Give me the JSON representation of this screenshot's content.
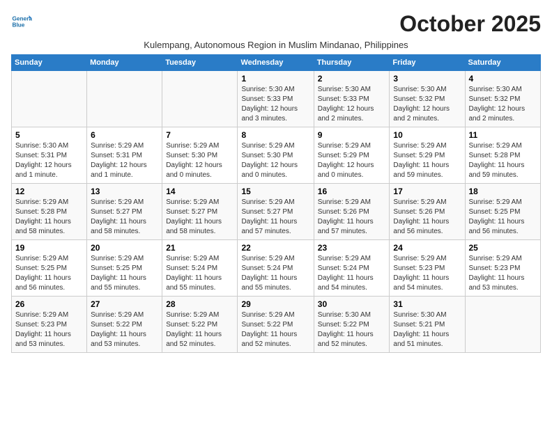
{
  "logo": {
    "name1": "General",
    "name2": "Blue"
  },
  "title": "October 2025",
  "subtitle": "Kulempang, Autonomous Region in Muslim Mindanao, Philippines",
  "headers": [
    "Sunday",
    "Monday",
    "Tuesday",
    "Wednesday",
    "Thursday",
    "Friday",
    "Saturday"
  ],
  "weeks": [
    [
      {
        "num": "",
        "info": ""
      },
      {
        "num": "",
        "info": ""
      },
      {
        "num": "",
        "info": ""
      },
      {
        "num": "1",
        "info": "Sunrise: 5:30 AM\nSunset: 5:33 PM\nDaylight: 12 hours and 3 minutes."
      },
      {
        "num": "2",
        "info": "Sunrise: 5:30 AM\nSunset: 5:33 PM\nDaylight: 12 hours and 2 minutes."
      },
      {
        "num": "3",
        "info": "Sunrise: 5:30 AM\nSunset: 5:32 PM\nDaylight: 12 hours and 2 minutes."
      },
      {
        "num": "4",
        "info": "Sunrise: 5:30 AM\nSunset: 5:32 PM\nDaylight: 12 hours and 2 minutes."
      }
    ],
    [
      {
        "num": "5",
        "info": "Sunrise: 5:30 AM\nSunset: 5:31 PM\nDaylight: 12 hours and 1 minute."
      },
      {
        "num": "6",
        "info": "Sunrise: 5:29 AM\nSunset: 5:31 PM\nDaylight: 12 hours and 1 minute."
      },
      {
        "num": "7",
        "info": "Sunrise: 5:29 AM\nSunset: 5:30 PM\nDaylight: 12 hours and 0 minutes."
      },
      {
        "num": "8",
        "info": "Sunrise: 5:29 AM\nSunset: 5:30 PM\nDaylight: 12 hours and 0 minutes."
      },
      {
        "num": "9",
        "info": "Sunrise: 5:29 AM\nSunset: 5:29 PM\nDaylight: 12 hours and 0 minutes."
      },
      {
        "num": "10",
        "info": "Sunrise: 5:29 AM\nSunset: 5:29 PM\nDaylight: 11 hours and 59 minutes."
      },
      {
        "num": "11",
        "info": "Sunrise: 5:29 AM\nSunset: 5:28 PM\nDaylight: 11 hours and 59 minutes."
      }
    ],
    [
      {
        "num": "12",
        "info": "Sunrise: 5:29 AM\nSunset: 5:28 PM\nDaylight: 11 hours and 58 minutes."
      },
      {
        "num": "13",
        "info": "Sunrise: 5:29 AM\nSunset: 5:27 PM\nDaylight: 11 hours and 58 minutes."
      },
      {
        "num": "14",
        "info": "Sunrise: 5:29 AM\nSunset: 5:27 PM\nDaylight: 11 hours and 58 minutes."
      },
      {
        "num": "15",
        "info": "Sunrise: 5:29 AM\nSunset: 5:27 PM\nDaylight: 11 hours and 57 minutes."
      },
      {
        "num": "16",
        "info": "Sunrise: 5:29 AM\nSunset: 5:26 PM\nDaylight: 11 hours and 57 minutes."
      },
      {
        "num": "17",
        "info": "Sunrise: 5:29 AM\nSunset: 5:26 PM\nDaylight: 11 hours and 56 minutes."
      },
      {
        "num": "18",
        "info": "Sunrise: 5:29 AM\nSunset: 5:25 PM\nDaylight: 11 hours and 56 minutes."
      }
    ],
    [
      {
        "num": "19",
        "info": "Sunrise: 5:29 AM\nSunset: 5:25 PM\nDaylight: 11 hours and 56 minutes."
      },
      {
        "num": "20",
        "info": "Sunrise: 5:29 AM\nSunset: 5:25 PM\nDaylight: 11 hours and 55 minutes."
      },
      {
        "num": "21",
        "info": "Sunrise: 5:29 AM\nSunset: 5:24 PM\nDaylight: 11 hours and 55 minutes."
      },
      {
        "num": "22",
        "info": "Sunrise: 5:29 AM\nSunset: 5:24 PM\nDaylight: 11 hours and 55 minutes."
      },
      {
        "num": "23",
        "info": "Sunrise: 5:29 AM\nSunset: 5:24 PM\nDaylight: 11 hours and 54 minutes."
      },
      {
        "num": "24",
        "info": "Sunrise: 5:29 AM\nSunset: 5:23 PM\nDaylight: 11 hours and 54 minutes."
      },
      {
        "num": "25",
        "info": "Sunrise: 5:29 AM\nSunset: 5:23 PM\nDaylight: 11 hours and 53 minutes."
      }
    ],
    [
      {
        "num": "26",
        "info": "Sunrise: 5:29 AM\nSunset: 5:23 PM\nDaylight: 11 hours and 53 minutes."
      },
      {
        "num": "27",
        "info": "Sunrise: 5:29 AM\nSunset: 5:22 PM\nDaylight: 11 hours and 53 minutes."
      },
      {
        "num": "28",
        "info": "Sunrise: 5:29 AM\nSunset: 5:22 PM\nDaylight: 11 hours and 52 minutes."
      },
      {
        "num": "29",
        "info": "Sunrise: 5:29 AM\nSunset: 5:22 PM\nDaylight: 11 hours and 52 minutes."
      },
      {
        "num": "30",
        "info": "Sunrise: 5:30 AM\nSunset: 5:22 PM\nDaylight: 11 hours and 52 minutes."
      },
      {
        "num": "31",
        "info": "Sunrise: 5:30 AM\nSunset: 5:21 PM\nDaylight: 11 hours and 51 minutes."
      },
      {
        "num": "",
        "info": ""
      }
    ]
  ]
}
